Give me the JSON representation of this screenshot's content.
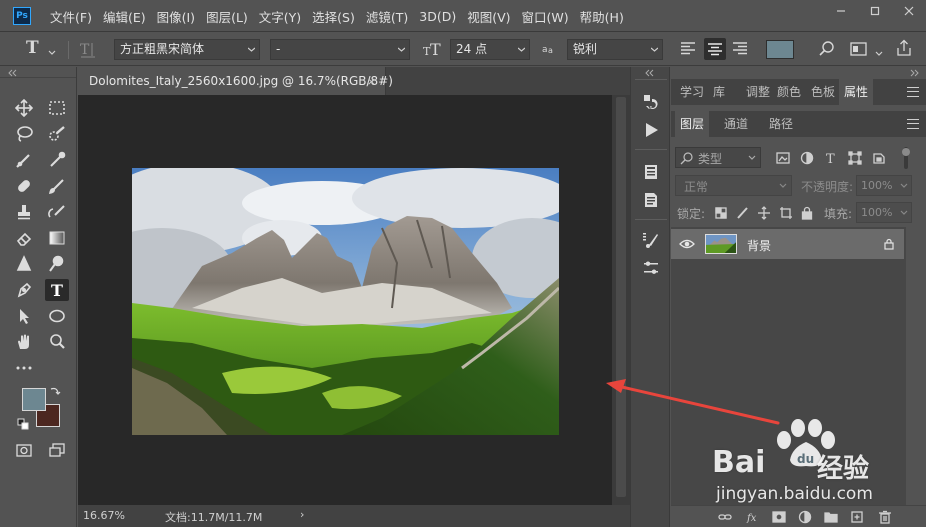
{
  "app": {
    "logo": "Ps",
    "menu": [
      "文件(F)",
      "编辑(E)",
      "图像(I)",
      "图层(L)",
      "文字(Y)",
      "选择(S)",
      "滤镜(T)",
      "3D(D)",
      "视图(V)",
      "窗口(W)",
      "帮助(H)"
    ],
    "window_controls": [
      "minimize-icon",
      "restore-icon",
      "close-icon"
    ]
  },
  "options_bar": {
    "font_family": "方正粗黑宋简体",
    "font_style": "-",
    "font_size": "24 点",
    "antialias": "锐利",
    "text_color": "#6d8791"
  },
  "document": {
    "tab_title": "Dolomites_Italy_2560x1600.jpg @ 16.7%(RGB/8#)",
    "tab_close": "×",
    "zoom": "16.67%",
    "doc_size": "文档:11.7M/11.7M",
    "status_arrow": "›"
  },
  "colors": {
    "foreground": "#6d8791",
    "background": "#4c2720",
    "accent_arrow": "#e8453c"
  },
  "panels": {
    "top_tabs": [
      "学习",
      "库",
      "调整",
      "颜色",
      "色板",
      "属性"
    ],
    "active_top_tab": "属性",
    "layer_tabs": [
      "图层",
      "通道",
      "路径"
    ],
    "active_layer_tab": "图层",
    "filter_kind": "类型",
    "blend_mode": "正常",
    "opacity_label": "不透明度:",
    "opacity_value": "100%",
    "lock_label": "锁定:",
    "fill_label": "填充:",
    "fill_value": "100%",
    "layers": [
      {
        "name": "背景",
        "visible": true,
        "locked": true
      }
    ]
  },
  "watermark": {
    "brand_left": "Bai",
    "brand_right": "经验",
    "url": "jingyan.baidu.com"
  }
}
